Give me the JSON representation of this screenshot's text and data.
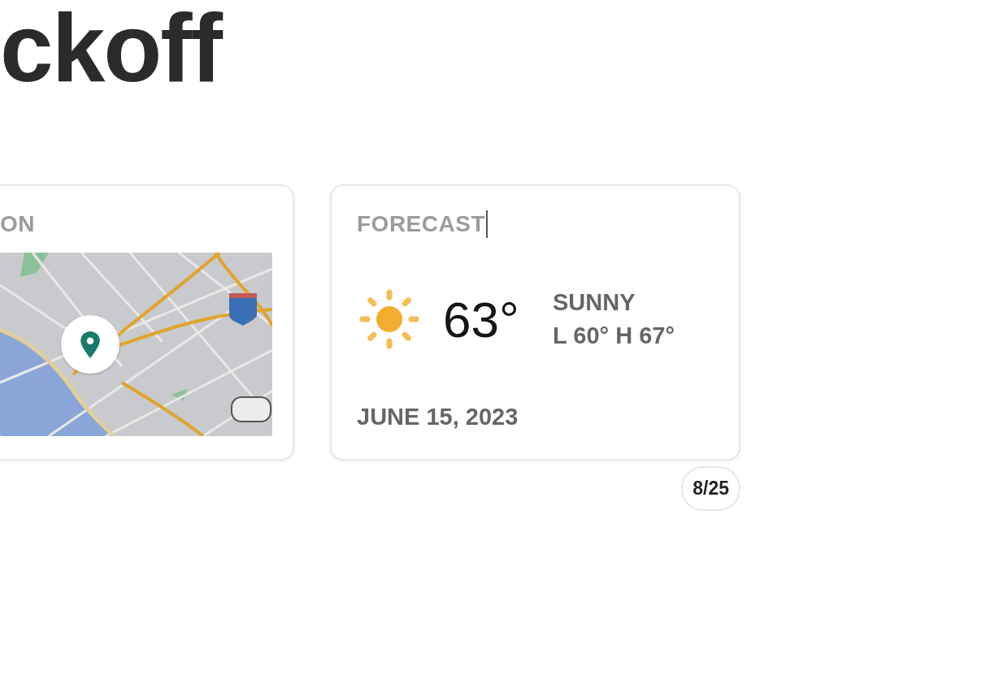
{
  "heading": "ckoff",
  "cards": [
    {
      "kind": "map",
      "title": "ON",
      "focused": false
    },
    {
      "kind": "weather",
      "title": "FORECAST",
      "focused": true,
      "temperature": "63°",
      "condition": "SUNNY",
      "range": "L 60° H 67°",
      "date": "JUNE 15, 2023"
    }
  ],
  "page_counter": "8/25"
}
